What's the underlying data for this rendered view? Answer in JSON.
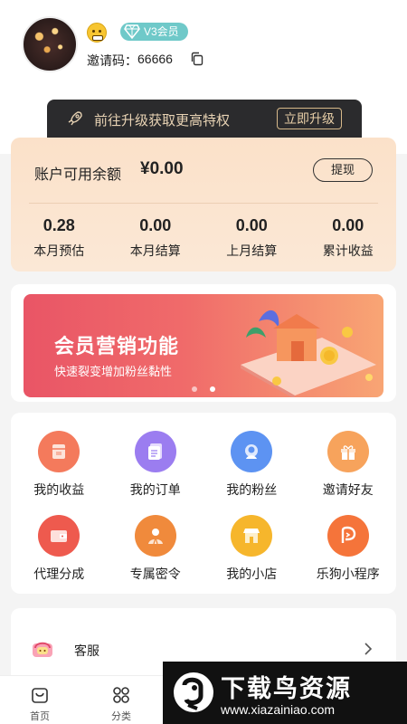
{
  "profile": {
    "vip_badge": "V3会员",
    "invite_label": "邀请码：",
    "invite_code": "66666"
  },
  "upgrade": {
    "text": "前往升级获取更高特权",
    "button": "立即升级"
  },
  "balance": {
    "label": "账户可用余额",
    "value": "¥0.00",
    "withdraw": "提现",
    "stats": [
      {
        "value": "0.28",
        "label": "本月预估"
      },
      {
        "value": "0.00",
        "label": "本月结算"
      },
      {
        "value": "0.00",
        "label": "上月结算"
      },
      {
        "value": "0.00",
        "label": "累计收益"
      }
    ]
  },
  "banner": {
    "title": "会员营销功能",
    "subtitle": "快速裂变增加粉丝黏性",
    "slides": 2,
    "active_slide": 2
  },
  "menu": [
    {
      "label": "我的收益",
      "icon": "income-icon",
      "color": "#f47a5c"
    },
    {
      "label": "我的订单",
      "icon": "order-icon",
      "color": "#9b7df0"
    },
    {
      "label": "我的粉丝",
      "icon": "fans-icon",
      "color": "#5d93f2"
    },
    {
      "label": "邀请好友",
      "icon": "gift-icon",
      "color": "#f7a35c"
    },
    {
      "label": "代理分成",
      "icon": "wallet-icon",
      "color": "#ee5a4e"
    },
    {
      "label": "专属密令",
      "icon": "person-icon",
      "color": "#f08a3c"
    },
    {
      "label": "我的小店",
      "icon": "shop-icon",
      "color": "#f6b62c"
    },
    {
      "label": "乐狗小程序",
      "icon": "miniapp-icon",
      "color": "#f5743a"
    }
  ],
  "service": {
    "label": "客服"
  },
  "tabs": [
    {
      "label": "首页",
      "icon": "home-icon"
    },
    {
      "label": "分类",
      "icon": "category-icon"
    }
  ],
  "watermark": {
    "title": "下载鸟资源",
    "url": "www.xiazainiao.com"
  },
  "colors": {
    "badge": "#6fc9c9",
    "upgrade_bg": "#2b2b2d",
    "upgrade_text": "#e8d3b4",
    "balance_card": "#fbe4cf",
    "banner_start": "#e95566",
    "banner_end": "#f8a574"
  }
}
